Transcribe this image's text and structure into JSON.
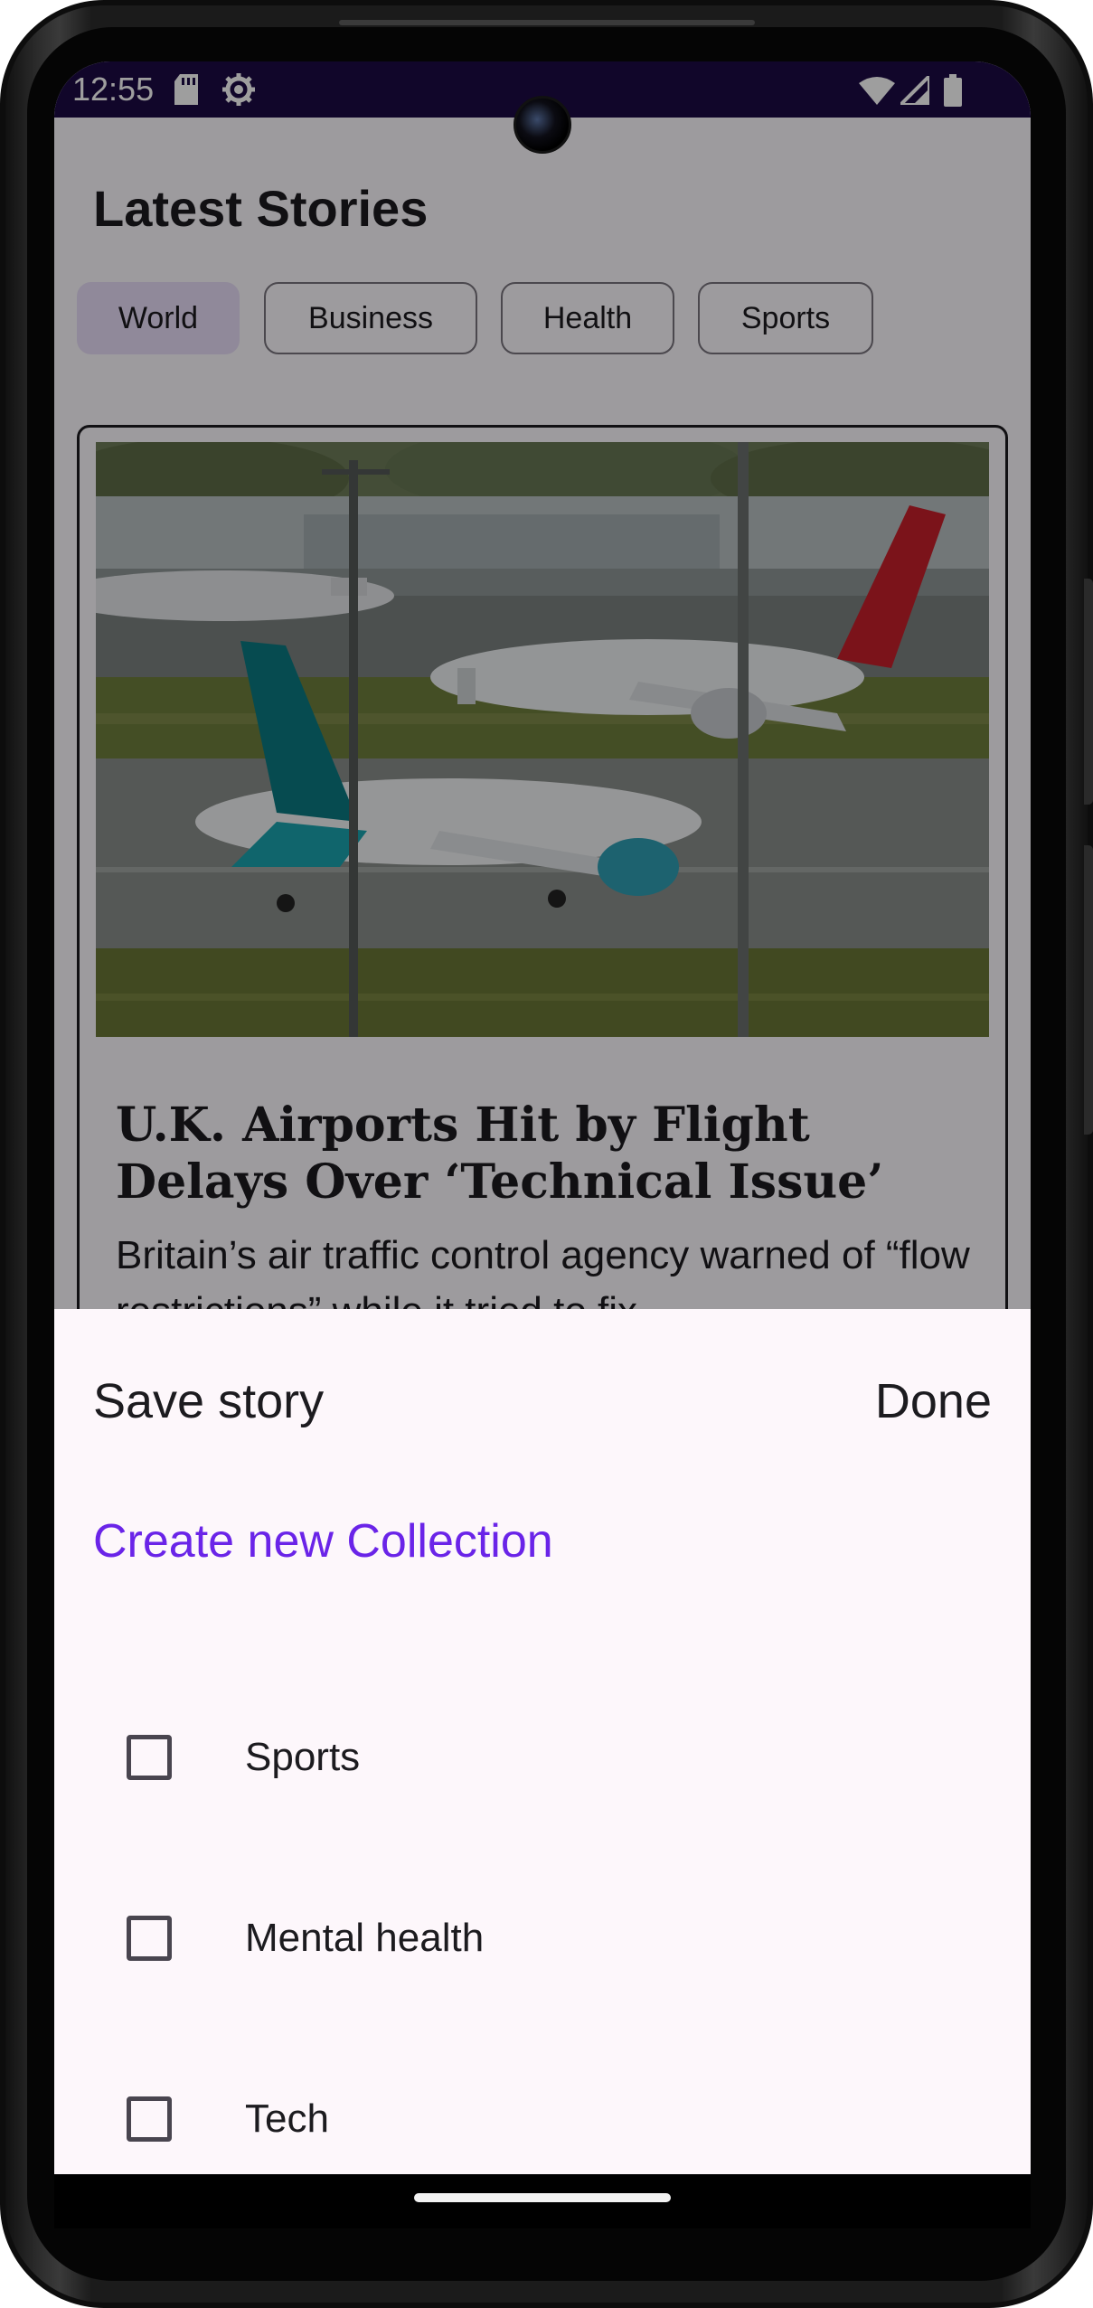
{
  "status_bar": {
    "time": "12:55",
    "icons": [
      "sd-card-icon",
      "settings-icon",
      "wifi-icon",
      "signal-icon",
      "battery-icon"
    ]
  },
  "app": {
    "title": "Latest Stories",
    "chips": [
      {
        "label": "World",
        "selected": true
      },
      {
        "label": "Business",
        "selected": false
      },
      {
        "label": "Health",
        "selected": false
      },
      {
        "label": "Sports",
        "selected": false
      }
    ],
    "card": {
      "headline": "U.K. Airports Hit by Flight Delays Over ‘Technical Issue’",
      "summary": "Britain’s air traffic control agency warned of “flow restrictions” while it tried to fix"
    }
  },
  "sheet": {
    "title": "Save story",
    "done_label": "Done",
    "create_label": "Create new Collection",
    "collections": [
      {
        "label": "Sports",
        "checked": false
      },
      {
        "label": "Mental health",
        "checked": false
      },
      {
        "label": "Tech",
        "checked": false
      }
    ]
  },
  "colors": {
    "status_bar": "#1c0a45",
    "accent": "#6a24e8",
    "sheet_bg": "#fdf7fb",
    "chip_selected": "#e8def8"
  }
}
